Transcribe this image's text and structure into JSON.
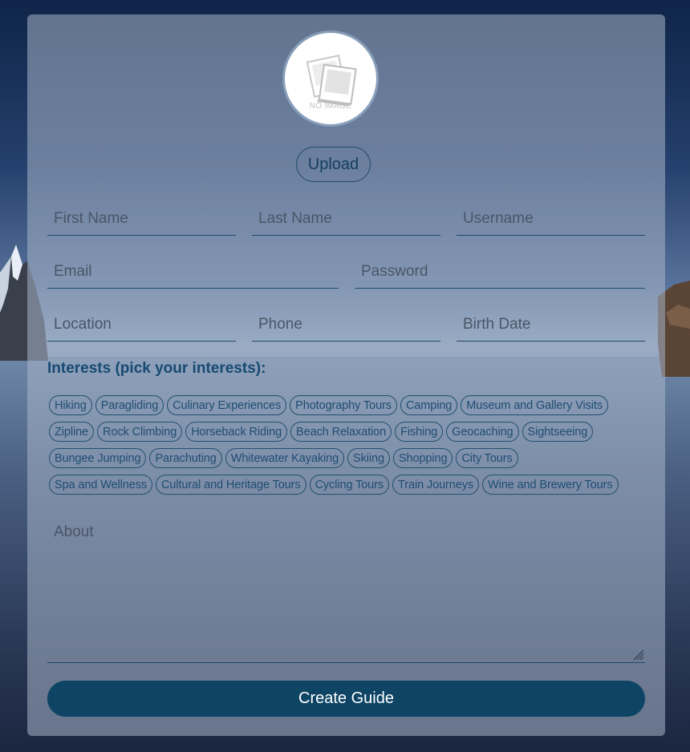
{
  "avatar": {
    "placeholder_text": "NO IMAGE",
    "icon": "photo-placeholder-icon"
  },
  "upload_label": "Upload",
  "fields": {
    "first_name": {
      "placeholder": "First Name",
      "value": ""
    },
    "last_name": {
      "placeholder": "Last Name",
      "value": ""
    },
    "username": {
      "placeholder": "Username",
      "value": ""
    },
    "email": {
      "placeholder": "Email",
      "value": ""
    },
    "password": {
      "placeholder": "Password",
      "value": ""
    },
    "location": {
      "placeholder": "Location",
      "value": ""
    },
    "phone": {
      "placeholder": "Phone",
      "value": ""
    },
    "birth_date": {
      "placeholder": "Birth Date",
      "value": ""
    }
  },
  "interests": {
    "title": "Interests (pick your interests):",
    "rows": [
      [
        "Hiking",
        "Paragliding",
        "Culinary Experiences",
        "Photography Tours",
        "Camping",
        "Museum and Gallery Visits"
      ],
      [
        "Zipline",
        "Rock Climbing",
        "Horseback Riding",
        "Beach Relaxation",
        "Fishing",
        "Geocaching",
        "Sightseeing"
      ],
      [
        "Bungee Jumping",
        "Parachuting",
        "Whitewater Kayaking",
        "Skiing",
        "Shopping",
        "City Tours"
      ],
      [
        "Spa and Wellness",
        "Cultural and Heritage Tours",
        "Cycling Tours",
        "Train Journeys",
        "Wine and Brewery Tours"
      ]
    ]
  },
  "about": {
    "placeholder": "About",
    "value": ""
  },
  "submit_label": "Create Guide",
  "colors": {
    "accent": "#0e4565",
    "border": "#1c4a6c",
    "tag_text": "#1f4d72"
  }
}
